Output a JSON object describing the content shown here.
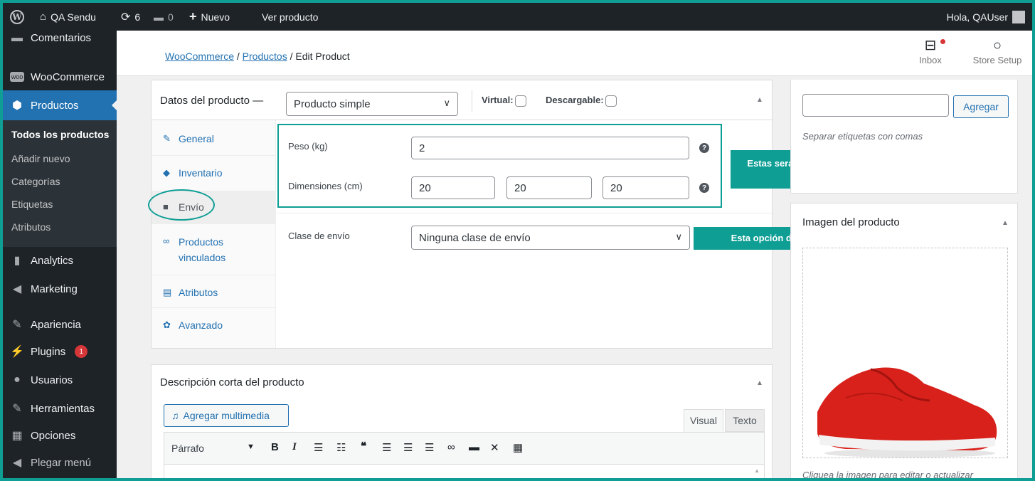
{
  "admin_bar": {
    "site_name": "QA Sendu",
    "updates_count": "6",
    "comments_count": "0",
    "new_label": "Nuevo",
    "view_product": "Ver producto",
    "greeting": "Hola, QAUser"
  },
  "sidebar": {
    "items": [
      {
        "label": "Comentarios",
        "icon": "comments-icon"
      },
      {
        "label": "WooCommerce",
        "icon": "woocommerce-icon"
      },
      {
        "label": "Productos",
        "icon": "products-icon"
      },
      {
        "label": "Analytics",
        "icon": "analytics-icon"
      },
      {
        "label": "Marketing",
        "icon": "marketing-icon"
      },
      {
        "label": "Apariencia",
        "icon": "appearance-icon"
      },
      {
        "label": "Plugins",
        "icon": "plugins-icon",
        "badge": "1"
      },
      {
        "label": "Usuarios",
        "icon": "users-icon"
      },
      {
        "label": "Herramientas",
        "icon": "tools-icon"
      },
      {
        "label": "Opciones",
        "icon": "settings-icon"
      },
      {
        "label": "Plegar menú",
        "icon": "collapse-icon"
      }
    ],
    "submenu": [
      "Todos los productos",
      "Añadir nuevo",
      "Categorías",
      "Etiquetas",
      "Atributos"
    ]
  },
  "header": {
    "breadcrumb": {
      "woocommerce": "WooCommerce",
      "products": "Productos",
      "current": "Edit Product"
    },
    "inbox_label": "Inbox",
    "store_setup_label": "Store Setup"
  },
  "product_data": {
    "title": "Datos del producto —",
    "type_selected": "Producto simple",
    "virtual_label": "Virtual:",
    "downloadable_label": "Descargable:",
    "tabs": [
      {
        "label": "General",
        "icon": "wrench-icon"
      },
      {
        "label": "Inventario",
        "icon": "tag-icon"
      },
      {
        "label": "Envío",
        "icon": "truck-icon"
      },
      {
        "label": "Productos vinculados",
        "icon": "link-icon"
      },
      {
        "label": "Atributos",
        "icon": "list-icon"
      },
      {
        "label": "Avanzado",
        "icon": "gear-icon"
      }
    ],
    "weight_label": "Peso (kg)",
    "weight_value": "2",
    "dimensions_label": "Dimensiones (cm)",
    "length": "20",
    "width": "20",
    "height": "20",
    "shipping_class_label": "Clase de envío",
    "shipping_class_value": "Ninguna clase de envío"
  },
  "callouts": {
    "dimensions": "Estas serán las dimensiones que Sendu tarificará y mostrarás a tu cliente final",
    "shipping_class": "Esta opción debes dejarla por defecto"
  },
  "short_description": {
    "title": "Descripción corta del producto",
    "add_media": "Agregar multimedia",
    "tab_visual": "Visual",
    "tab_text": "Texto",
    "format_selected": "Párrafo"
  },
  "tags_box": {
    "add_button": "Agregar",
    "hint": "Separar etiquetas con comas"
  },
  "image_box": {
    "title": "Imagen del producto",
    "hint": "Cliquea la imagen para editar o actualizar"
  },
  "colors": {
    "accent": "#2271b1",
    "callout": "#0e9e94",
    "sidebar": "#1d2327"
  }
}
